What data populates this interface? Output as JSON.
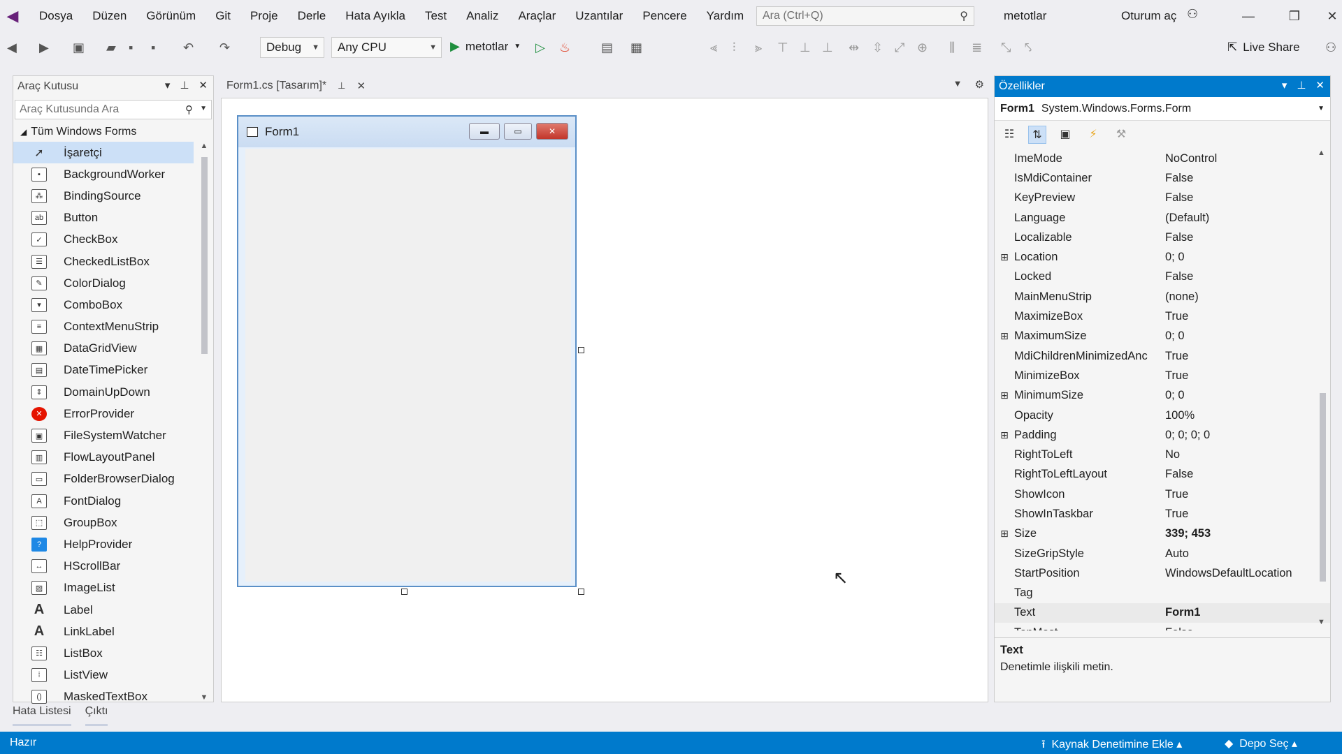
{
  "menu": {
    "items": [
      "Dosya",
      "Düzen",
      "Görünüm",
      "Git",
      "Proje",
      "Derle",
      "Hata Ayıkla",
      "Test",
      "Analiz",
      "Araçlar",
      "Uzantılar",
      "Pencere",
      "Yardım"
    ],
    "search_placeholder": "Ara (Ctrl+Q)",
    "solution_name": "metotlar",
    "sign_in": "Oturum aç"
  },
  "toolbar": {
    "config": "Debug",
    "platform": "Any CPU",
    "run_target": "metotlar",
    "live_share": "Live Share"
  },
  "toolbox": {
    "title": "Araç Kutusu",
    "search_placeholder": "Araç Kutusunda Ara",
    "group": "Tüm Windows Forms",
    "items": [
      {
        "label": "İşaretçi",
        "icon": "pointer-icon",
        "glyph": "➚"
      },
      {
        "label": "BackgroundWorker",
        "icon": "background-worker-icon",
        "glyph": "▪"
      },
      {
        "label": "BindingSource",
        "icon": "binding-source-icon",
        "glyph": "⁂"
      },
      {
        "label": "Button",
        "icon": "button-icon",
        "glyph": "ab"
      },
      {
        "label": "CheckBox",
        "icon": "checkbox-icon",
        "glyph": "✓"
      },
      {
        "label": "CheckedListBox",
        "icon": "checked-list-box-icon",
        "glyph": "☰"
      },
      {
        "label": "ColorDialog",
        "icon": "color-dialog-icon",
        "glyph": "✎"
      },
      {
        "label": "ComboBox",
        "icon": "combobox-icon",
        "glyph": "▾"
      },
      {
        "label": "ContextMenuStrip",
        "icon": "context-menu-strip-icon",
        "glyph": "≡"
      },
      {
        "label": "DataGridView",
        "icon": "data-grid-view-icon",
        "glyph": "▦"
      },
      {
        "label": "DateTimePicker",
        "icon": "date-time-picker-icon",
        "glyph": "▤"
      },
      {
        "label": "DomainUpDown",
        "icon": "domain-up-down-icon",
        "glyph": "⇕"
      },
      {
        "label": "ErrorProvider",
        "icon": "error-provider-icon",
        "glyph": "✕"
      },
      {
        "label": "FileSystemWatcher",
        "icon": "file-system-watcher-icon",
        "glyph": "▣"
      },
      {
        "label": "FlowLayoutPanel",
        "icon": "flow-layout-panel-icon",
        "glyph": "▥"
      },
      {
        "label": "FolderBrowserDialog",
        "icon": "folder-browser-dialog-icon",
        "glyph": "▭"
      },
      {
        "label": "FontDialog",
        "icon": "font-dialog-icon",
        "glyph": "A"
      },
      {
        "label": "GroupBox",
        "icon": "group-box-icon",
        "glyph": "⬚"
      },
      {
        "label": "HelpProvider",
        "icon": "help-provider-icon",
        "glyph": "?"
      },
      {
        "label": "HScrollBar",
        "icon": "hscrollbar-icon",
        "glyph": "↔"
      },
      {
        "label": "ImageList",
        "icon": "image-list-icon",
        "glyph": "▨"
      },
      {
        "label": "Label",
        "icon": "label-icon",
        "glyph": "A"
      },
      {
        "label": "LinkLabel",
        "icon": "link-label-icon",
        "glyph": "A"
      },
      {
        "label": "ListBox",
        "icon": "list-box-icon",
        "glyph": "☷"
      },
      {
        "label": "ListView",
        "icon": "list-view-icon",
        "glyph": "⁞"
      },
      {
        "label": "MaskedTextBox",
        "icon": "masked-textbox-icon",
        "glyph": "()"
      }
    ]
  },
  "bottom_tabs": [
    "Hata Listesi",
    "Çıktı"
  ],
  "document": {
    "tab_label": "Form1.cs [Tasarım]*",
    "form_title": "Form1"
  },
  "properties": {
    "title": "Özellikler",
    "object_name": "Form1",
    "object_type": "System.Windows.Forms.Form",
    "rows": [
      {
        "name": "ImeMode",
        "value": "NoControl",
        "expandable": false,
        "bold": false
      },
      {
        "name": "IsMdiContainer",
        "value": "False",
        "expandable": false,
        "bold": false
      },
      {
        "name": "KeyPreview",
        "value": "False",
        "expandable": false,
        "bold": false
      },
      {
        "name": "Language",
        "value": "(Default)",
        "expandable": false,
        "bold": false
      },
      {
        "name": "Localizable",
        "value": "False",
        "expandable": false,
        "bold": false
      },
      {
        "name": "Location",
        "value": "0; 0",
        "expandable": true,
        "bold": false
      },
      {
        "name": "Locked",
        "value": "False",
        "expandable": false,
        "bold": false
      },
      {
        "name": "MainMenuStrip",
        "value": "(none)",
        "expandable": false,
        "bold": false
      },
      {
        "name": "MaximizeBox",
        "value": "True",
        "expandable": false,
        "bold": false
      },
      {
        "name": "MaximumSize",
        "value": "0; 0",
        "expandable": true,
        "bold": false
      },
      {
        "name": "MdiChildrenMinimizedAnc",
        "value": "True",
        "expandable": false,
        "bold": false
      },
      {
        "name": "MinimizeBox",
        "value": "True",
        "expandable": false,
        "bold": false
      },
      {
        "name": "MinimumSize",
        "value": "0; 0",
        "expandable": true,
        "bold": false
      },
      {
        "name": "Opacity",
        "value": "100%",
        "expandable": false,
        "bold": false
      },
      {
        "name": "Padding",
        "value": "0; 0; 0; 0",
        "expandable": true,
        "bold": false
      },
      {
        "name": "RightToLeft",
        "value": "No",
        "expandable": false,
        "bold": false
      },
      {
        "name": "RightToLeftLayout",
        "value": "False",
        "expandable": false,
        "bold": false
      },
      {
        "name": "ShowIcon",
        "value": "True",
        "expandable": false,
        "bold": false
      },
      {
        "name": "ShowInTaskbar",
        "value": "True",
        "expandable": false,
        "bold": false
      },
      {
        "name": "Size",
        "value": "339; 453",
        "expandable": true,
        "bold": true
      },
      {
        "name": "SizeGripStyle",
        "value": "Auto",
        "expandable": false,
        "bold": false
      },
      {
        "name": "StartPosition",
        "value": "WindowsDefaultLocation",
        "expandable": false,
        "bold": false
      },
      {
        "name": "Tag",
        "value": "",
        "expandable": false,
        "bold": false
      },
      {
        "name": "Text",
        "value": "Form1",
        "expandable": false,
        "bold": true
      },
      {
        "name": "TopMost",
        "value": "False",
        "expandable": false,
        "bold": false
      }
    ],
    "description_title": "Text",
    "description_text": "Denetimle ilişkili metin."
  },
  "status": {
    "ready": "Hazır",
    "source_control": "Kaynak Denetimine Ekle",
    "repo": "Depo Seç"
  },
  "colors": {
    "accent": "#007acc",
    "selection": "#cce0f7"
  }
}
